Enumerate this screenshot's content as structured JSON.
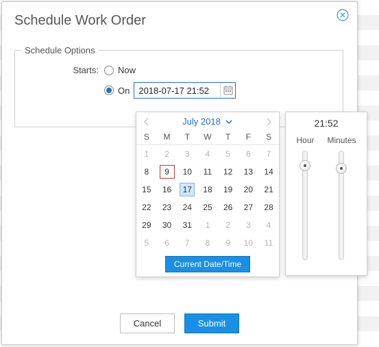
{
  "dialog": {
    "title": "Schedule Work Order"
  },
  "schedule": {
    "legend": "Schedule Options",
    "starts_label": "Starts:",
    "now_label": "Now",
    "on_label": "On",
    "on_value": "2018-07-17 21:52",
    "selected": "on"
  },
  "calendar": {
    "month_label": "July 2018",
    "weekdays": [
      "S",
      "M",
      "T",
      "W",
      "T",
      "F",
      "S"
    ],
    "weeks": [
      [
        {
          "d": 1,
          "out": true
        },
        {
          "d": 2,
          "out": true
        },
        {
          "d": 3,
          "out": true
        },
        {
          "d": 4,
          "out": true
        },
        {
          "d": 5,
          "out": true
        },
        {
          "d": 6,
          "out": true
        },
        {
          "d": 7,
          "out": true
        }
      ],
      [
        {
          "d": 8
        },
        {
          "d": 9,
          "today": true
        },
        {
          "d": 10
        },
        {
          "d": 11
        },
        {
          "d": 12
        },
        {
          "d": 13
        },
        {
          "d": 14
        }
      ],
      [
        {
          "d": 15
        },
        {
          "d": 16
        },
        {
          "d": 17,
          "selected": true
        },
        {
          "d": 18
        },
        {
          "d": 19
        },
        {
          "d": 20
        },
        {
          "d": 21
        }
      ],
      [
        {
          "d": 22
        },
        {
          "d": 23
        },
        {
          "d": 24
        },
        {
          "d": 25
        },
        {
          "d": 26
        },
        {
          "d": 27
        },
        {
          "d": 28
        }
      ],
      [
        {
          "d": 29
        },
        {
          "d": 30
        },
        {
          "d": 31
        },
        {
          "d": 1,
          "out": true
        },
        {
          "d": 2,
          "out": true
        },
        {
          "d": 3,
          "out": true
        },
        {
          "d": 4,
          "out": true
        }
      ],
      [
        {
          "d": 5,
          "out": true
        },
        {
          "d": 6,
          "out": true
        },
        {
          "d": 7,
          "out": true
        },
        {
          "d": 8,
          "out": true
        },
        {
          "d": 9,
          "out": true
        },
        {
          "d": 10,
          "out": true
        },
        {
          "d": 11,
          "out": true
        }
      ]
    ],
    "current_dt_label": "Current Date/Time"
  },
  "time": {
    "display": "21:52",
    "hour_label": "Hour",
    "minutes_label": "Minutes",
    "hour_value": 21,
    "minute_value": 52,
    "hour_max": 23,
    "minute_max": 59
  },
  "buttons": {
    "cancel": "Cancel",
    "submit": "Submit"
  },
  "colors": {
    "accent": "#1a8fe6",
    "today_border": "#c1392b"
  }
}
